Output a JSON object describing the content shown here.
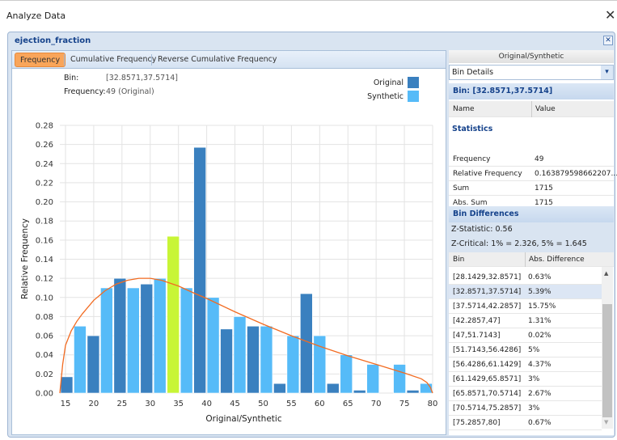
{
  "window": {
    "title": "Analyze Data",
    "close_icon": "close-icon"
  },
  "panel": {
    "title": "ejection_fraction"
  },
  "tabs": [
    {
      "label": "Frequency",
      "active": true
    },
    {
      "label": "Cumulative Frequency"
    },
    {
      "label": "Reverse Cumulative Frequency"
    }
  ],
  "info": {
    "bin_label": "Bin:",
    "bin_value": "[32.8571,37.5714]",
    "freq_label": "Frequency:",
    "freq_value": "49 (Original)"
  },
  "legend": [
    {
      "label": "Original",
      "color": "#3a80bf"
    },
    {
      "label": "Synthetic",
      "color": "#56bbf8"
    }
  ],
  "chart_data": {
    "type": "bar",
    "xlabel": "Original/Synthetic",
    "ylabel": "Relative Frequency",
    "xlim": [
      14,
      80
    ],
    "ylim": [
      0,
      0.28
    ],
    "xticks": [
      15,
      20,
      25,
      30,
      35,
      40,
      45,
      50,
      55,
      60,
      65,
      70,
      75,
      80
    ],
    "yticks": [
      "0.00",
      "0.02",
      "0.04",
      "0.06",
      "0.08",
      "0.10",
      "0.12",
      "0.14",
      "0.16",
      "0.18",
      "0.20",
      "0.22",
      "0.24",
      "0.26",
      "0.28"
    ],
    "grid": true,
    "legend_placement": "top-right",
    "bin_edges": [
      14,
      18.7143,
      23.4286,
      28.1429,
      32.8571,
      37.5714,
      42.2857,
      47,
      51.7143,
      56.4286,
      61.1429,
      65.8571,
      70.5714,
      75.2857,
      80
    ],
    "series": [
      {
        "name": "Original",
        "color": "#3a80bf",
        "values": [
          0.017,
          0.06,
          0.12,
          0.114,
          0.164,
          0.257,
          0.067,
          0.07,
          0.01,
          0.104,
          0.01,
          0.003,
          0,
          0.003
        ]
      },
      {
        "name": "Synthetic",
        "color": "#56bbf8",
        "values": [
          0.07,
          0.11,
          0.11,
          0.12,
          0.11,
          0.1,
          0.08,
          0.07,
          0.06,
          0.06,
          0.04,
          0.03,
          0.03,
          0.01
        ]
      }
    ],
    "highlight": {
      "series": "Original",
      "bin_index": 4,
      "color": "#c8f536"
    },
    "density_curve": {
      "color": "#f26b21",
      "x": [
        14,
        14.5,
        15,
        16,
        17,
        18,
        20,
        22,
        24,
        26,
        28,
        30,
        32,
        35,
        38,
        40,
        45,
        50,
        55,
        60,
        65,
        70,
        75,
        78,
        79,
        79.6,
        80
      ],
      "y": [
        0,
        0.03,
        0.05,
        0.065,
        0.075,
        0.083,
        0.097,
        0.107,
        0.114,
        0.118,
        0.12,
        0.12,
        0.118,
        0.112,
        0.104,
        0.099,
        0.085,
        0.072,
        0.06,
        0.049,
        0.039,
        0.03,
        0.021,
        0.015,
        0.011,
        0.006,
        0
      ]
    }
  },
  "right": {
    "header": "Original/Synthetic",
    "dropdown": "Bin Details",
    "bin_title": "Bin: [32.8571,37.5714]",
    "cols": [
      "Name",
      "Value"
    ],
    "stats_title": "Statistics",
    "stats": [
      [
        "Frequency",
        "49"
      ],
      [
        "Relative Frequency",
        "0.163879598662207..."
      ],
      [
        "Sum",
        "1715"
      ],
      [
        "Abs. Sum",
        "1715"
      ]
    ],
    "diff_title": "Bin Differences",
    "z_stat": "Z-Statistic: 0.56",
    "z_crit": "Z-Critical: 1% = 2.326, 5% = 1.645",
    "diff_cols": [
      "Bin",
      "Abs. Difference"
    ],
    "diffs": [
      [
        "[28.1429,32.8571]",
        "0.63%"
      ],
      [
        "[32.8571,37.5714]",
        "5.39%"
      ],
      [
        "[37.5714,42.2857]",
        "15.75%"
      ],
      [
        "[42.2857,47]",
        "1.31%"
      ],
      [
        "[47,51.7143]",
        "0.02%"
      ],
      [
        "[51.7143,56.4286]",
        "5%"
      ],
      [
        "[56.4286,61.1429]",
        "4.37%"
      ],
      [
        "[61.1429,65.8571]",
        "3%"
      ],
      [
        "[65.8571,70.5714]",
        "2.67%"
      ],
      [
        "[70.5714,75.2857]",
        "3%"
      ],
      [
        "[75.2857,80]",
        "0.67%"
      ]
    ],
    "selected_diff": 1
  }
}
